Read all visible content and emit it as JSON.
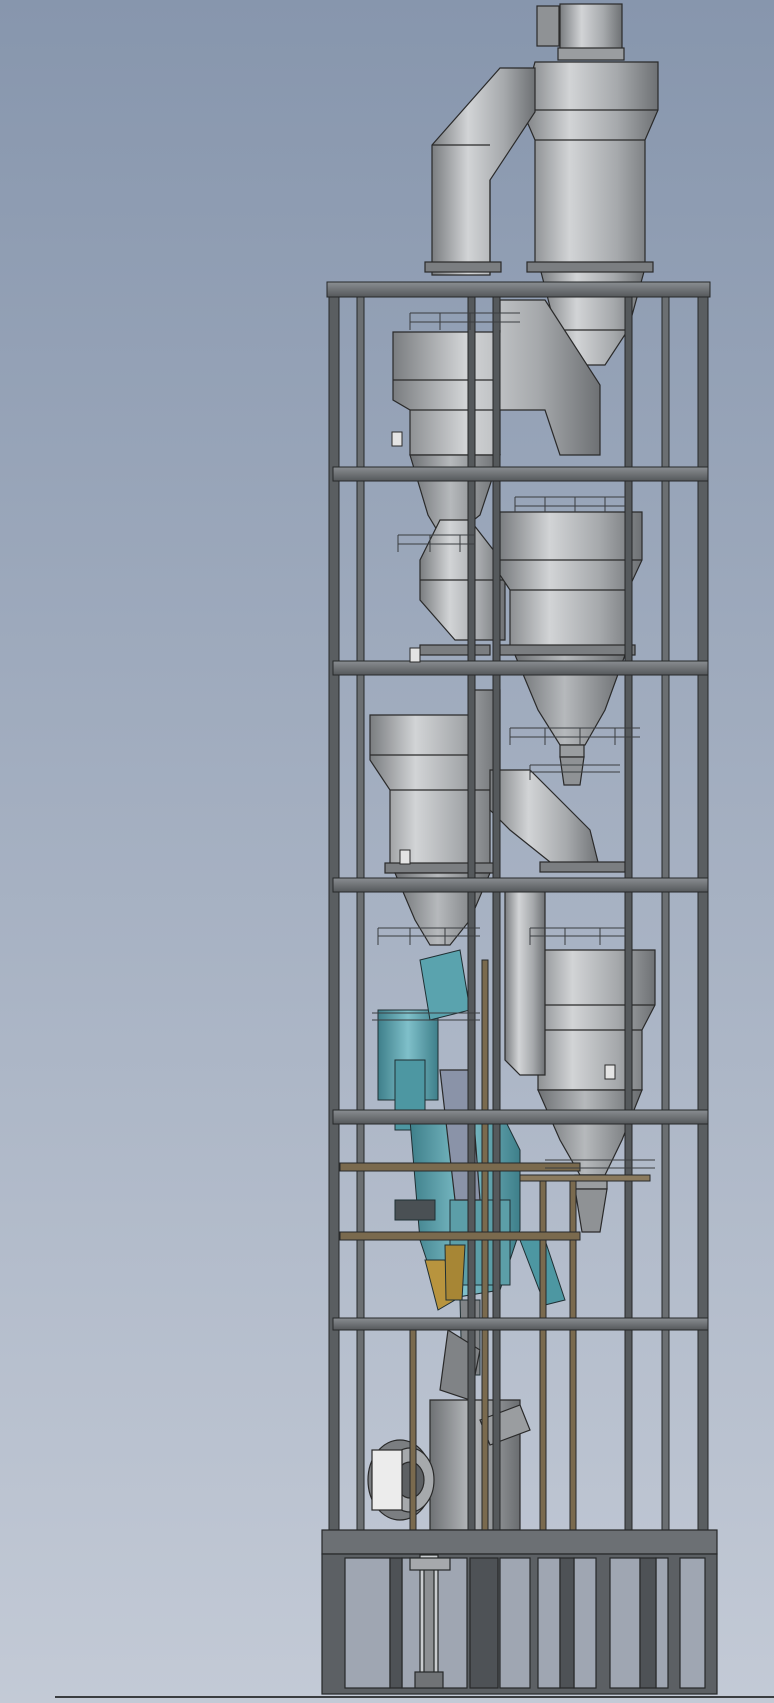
{
  "scene": {
    "subject": "preheater-tower-cad-render",
    "background_top": "#8796ad",
    "background_bottom": "#c3cad6"
  },
  "palette": {
    "steel": "#666a6e",
    "steel_light": "#8a8e92",
    "steel_shadow": "#3c3f42",
    "steel_ochre": "#7a6a4e",
    "cyclone_light": "#d2d4d6",
    "cyclone_mid": "#a6a9ac",
    "cyclone_dark": "#7a7d80",
    "mill_teal": "#5fa4b0",
    "mill_teal_dark": "#3e7f8a",
    "gold": "#b8943e",
    "outline": "#2a2a2a"
  },
  "components": {
    "stages": [
      "cyclone-stage-1",
      "cyclone-stage-2",
      "cyclone-stage-3",
      "cyclone-stage-4"
    ],
    "floor_levels": 7,
    "base": "concrete-base-frame",
    "mill": "vertical-roller-mill",
    "fan": "induced-draft-fan"
  }
}
